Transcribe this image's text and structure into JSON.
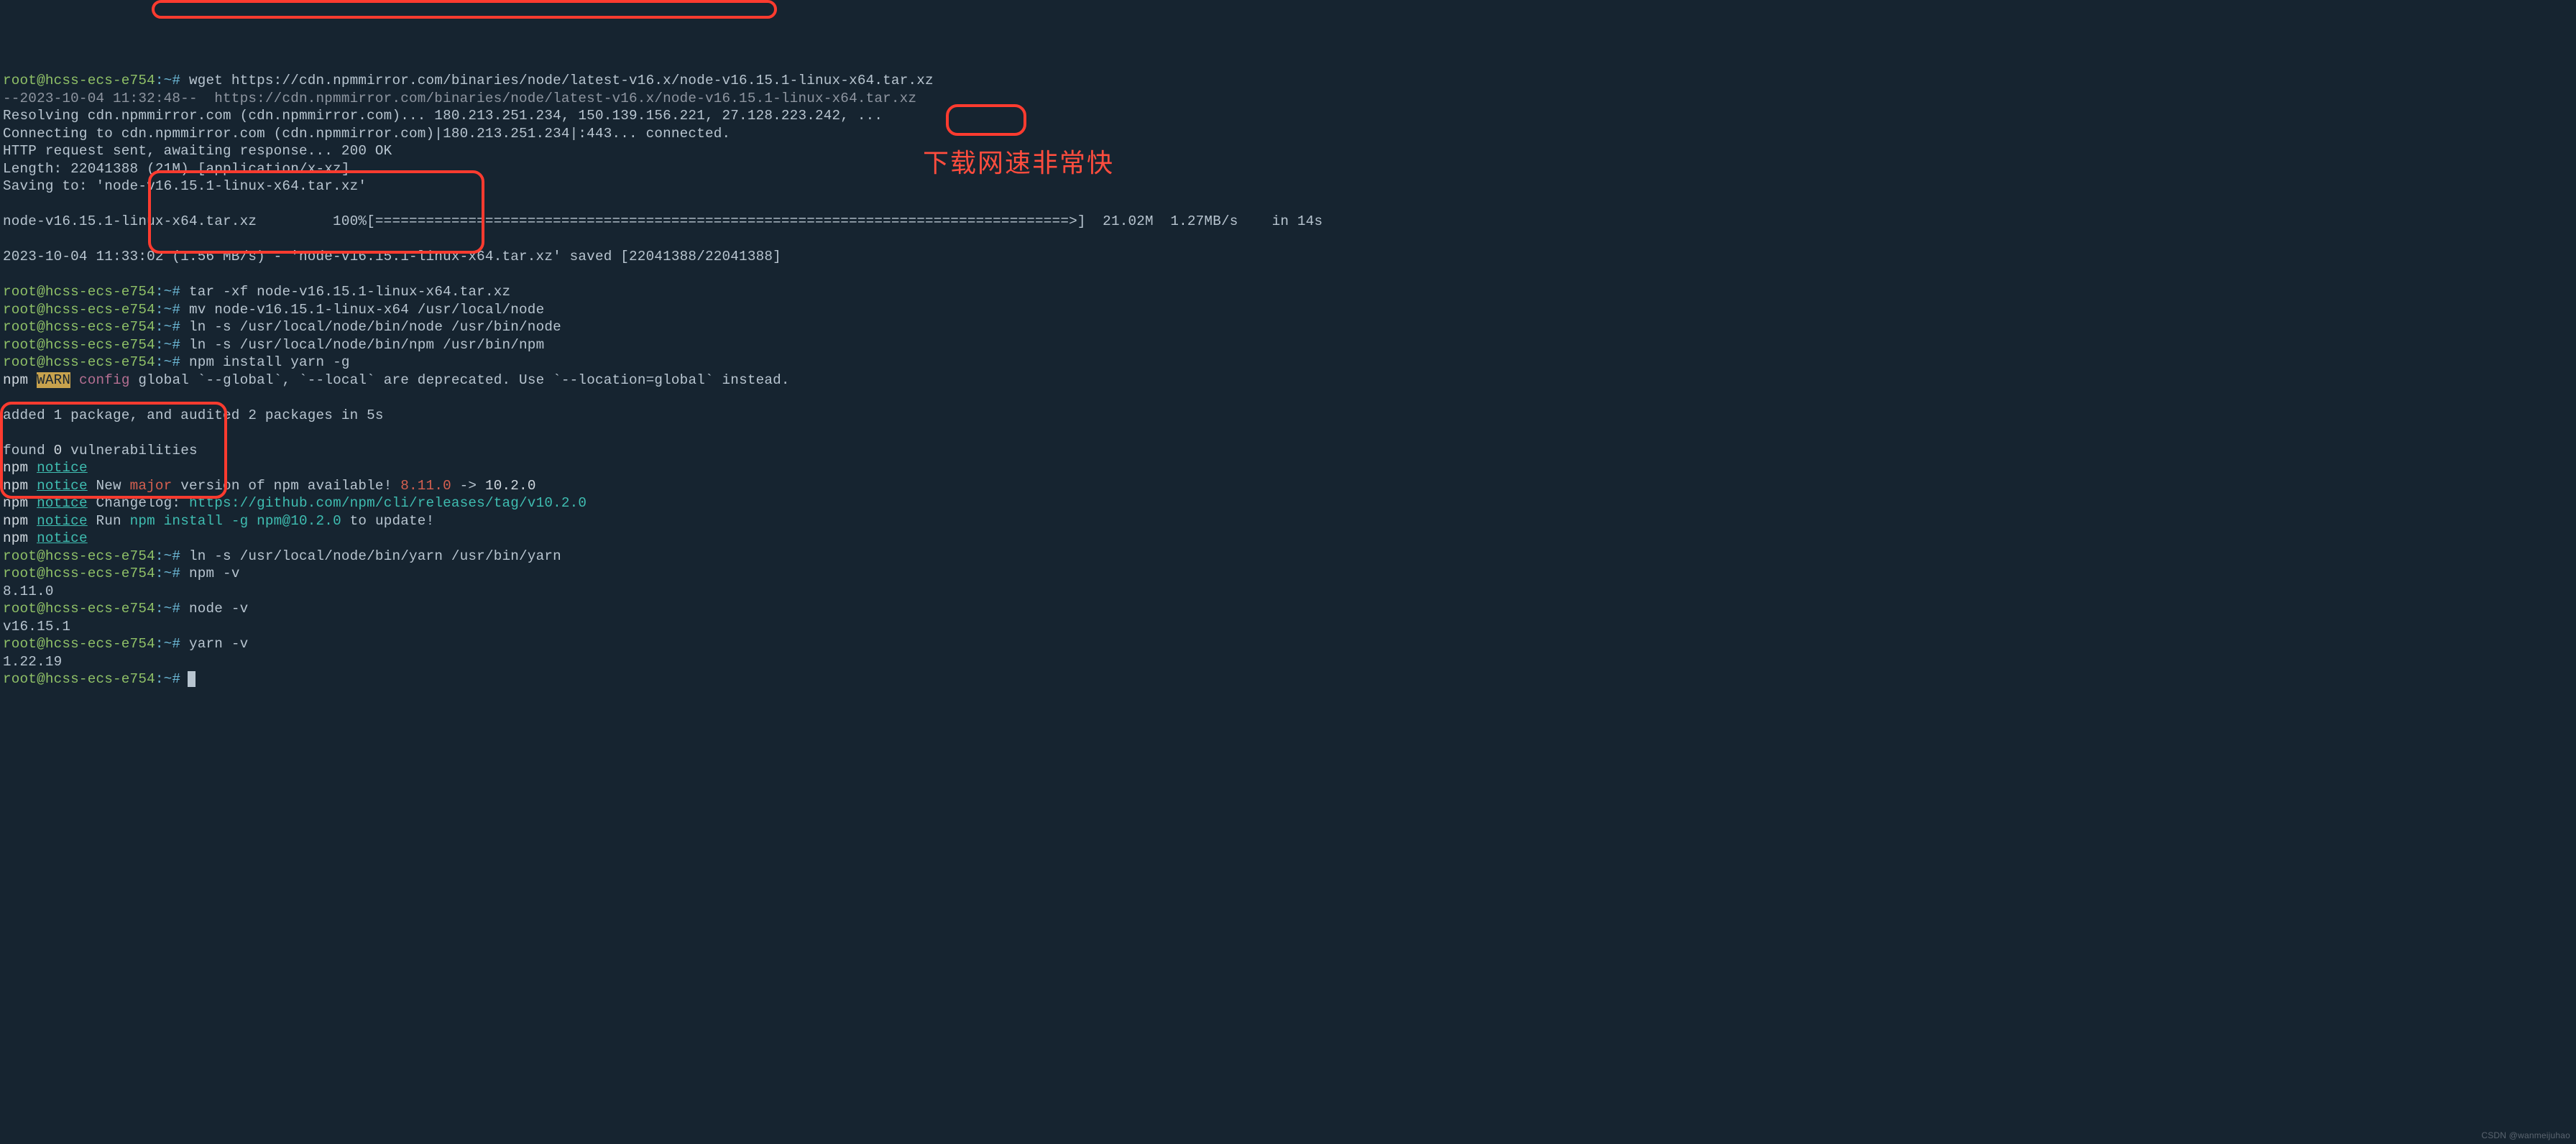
{
  "prompt": "root@hcss-ecs-e754",
  "tilde": ":~#",
  "lines": {
    "l1_cmd": "wget https://cdn.npmmirror.com/binaries/node/latest-v16.x/node-v16.15.1-linux-x64.tar.xz",
    "l2": "--2023-10-04 11:32:48--  https://cdn.npmmirror.com/binaries/node/latest-v16.x/node-v16.15.1-linux-x64.tar.xz",
    "l3": "Resolving cdn.npmmirror.com (cdn.npmmirror.com)... 180.213.251.234, 150.139.156.221, 27.128.223.242, ...",
    "l4": "Connecting to cdn.npmmirror.com (cdn.npmmirror.com)|180.213.251.234|:443... connected.",
    "l5": "HTTP request sent, awaiting response... 200 OK",
    "l6": "Length: 22041388 (21M) [application/x-xz]",
    "l7": "Saving to: 'node-v16.15.1-linux-x64.tar.xz'",
    "l8a": "node-v16.15.1-linux-x64.tar.xz         100%[==================================================================================>]  21.02M  1.27MB/s    in 14s",
    "l9": "2023-10-04 11:33:02 (1.56 MB/s) - 'node-v16.15.1-linux-x64.tar.xz' saved [22041388/22041388]",
    "l10_cmd": "tar -xf node-v16.15.1-linux-x64.tar.xz",
    "l11_cmd": "mv node-v16.15.1-linux-x64 /usr/local/node",
    "l12_cmd": "ln -s /usr/local/node/bin/node /usr/bin/node",
    "l13_cmd": "ln -s /usr/local/node/bin/npm /usr/bin/npm",
    "l14_cmd": "npm install yarn -g",
    "npm": "npm",
    "warn": "WARN",
    "config": "config",
    "l15": " global `--global`, `--local` are deprecated. Use `--location=global` instead.",
    "l16": "added 1 package, and audited 2 packages in 5s",
    "l17a": "found ",
    "l17b": "0",
    "l17c": " vulnerabilities",
    "notice": "notice",
    "l19a": " New ",
    "l19b": "major",
    "l19c": " version of npm available! ",
    "l19d": "8.11.0",
    "l19e": " -> ",
    "l19f": "10.2.0",
    "l20a": " Changelog: ",
    "l20b": "https://github.com/npm/cli/releases/tag/v10.2.0",
    "l21a": " Run ",
    "l21b": "npm install -g npm@10.2.0",
    "l21c": " to update!",
    "l23_cmd": "ln -s /usr/local/node/bin/yarn /usr/bin/yarn",
    "l24_cmd": "npm -v",
    "l25": "8.11.0",
    "l26_cmd": "node -v",
    "l27": "v16.15.1",
    "l28_cmd": "yarn -v",
    "l29": "1.22.19"
  },
  "annotation": "下载网速非常快",
  "watermark": "CSDN @wanmeijuhao"
}
